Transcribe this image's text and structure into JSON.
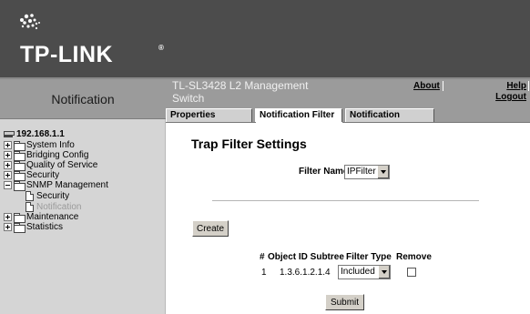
{
  "brand": {
    "logo_text": "TP-LINK",
    "trademark": "®"
  },
  "sidebar": {
    "title": "Notification",
    "root": "192.168.1.1",
    "items": [
      {
        "label": "System Info"
      },
      {
        "label": "Bridging Config"
      },
      {
        "label": "Quality of Service"
      },
      {
        "label": "Security"
      },
      {
        "label": "SNMP Management"
      },
      {
        "label": "Security"
      },
      {
        "label": "Notification"
      },
      {
        "label": "Maintenance"
      },
      {
        "label": "Statistics"
      }
    ]
  },
  "header": {
    "device_title": "TL-SL3428 L2 Management Switch",
    "about": "About",
    "help": "Help",
    "logout": "Logout"
  },
  "tabs": [
    {
      "label": "Properties"
    },
    {
      "label": "Notification Filter"
    },
    {
      "label": "Notification Receiver"
    }
  ],
  "main": {
    "heading": "Trap Filter Settings",
    "filter_name_label": "Filter Name",
    "filter_name_value": "IPFilter",
    "create_label": "Create",
    "table": {
      "headers": [
        "#",
        "Object ID Subtree",
        "Filter Type",
        "Remove"
      ],
      "rows": [
        {
          "index": "1",
          "oid": "1.3.6.1.2.1.4",
          "filter_type": "Included",
          "remove": false
        }
      ]
    },
    "submit_label": "Submit"
  },
  "colors": {
    "banner": "#4c4c4c",
    "header_gray": "#9b9b9b",
    "sidebar": "#d5d5d5",
    "button_face": "#d4d0c8"
  }
}
